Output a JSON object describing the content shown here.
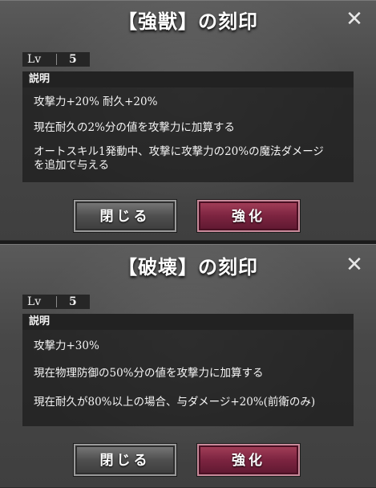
{
  "panels": [
    {
      "title": "【強獣】の刻印",
      "lv_label": "Lv",
      "lv_value": "5",
      "desc_header": "説明",
      "lines": [
        "攻撃力+20%  耐久+20%",
        "現在耐久の2%分の値を攻撃力に加算する",
        "オートスキル1発動中、攻撃に攻撃力の20%の魔法ダメージ",
        "を追加で与える"
      ],
      "close_button": "閉じる",
      "enhance_button": "強化",
      "close_icon": "close-icon"
    },
    {
      "title": "【破壊】の刻印",
      "lv_label": "Lv",
      "lv_value": "5",
      "desc_header": "説明",
      "lines": [
        "攻撃力+30%",
        "現在物理防御の50%分の値を攻撃力に加算する",
        "現在耐久が80%以上の場合、与ダメージ+20%(前衛のみ)"
      ],
      "close_button": "閉じる",
      "enhance_button": "強化",
      "close_icon": "close-icon"
    }
  ],
  "colors": {
    "enhance_button": "#7c2440",
    "close_button": "#4f4f4f",
    "panel_bg": "#474747"
  }
}
